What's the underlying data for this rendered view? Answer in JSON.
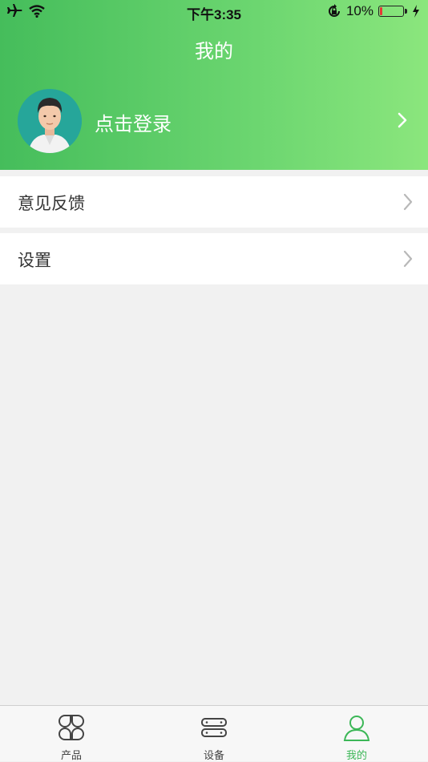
{
  "status_bar": {
    "time": "下午3:35",
    "battery_text": "10%",
    "battery_level": 0.1,
    "icons": [
      "airplane-icon",
      "wifi-icon",
      "rotation-lock-icon",
      "battery-icon",
      "charging-icon"
    ]
  },
  "header": {
    "title": "我的",
    "login_label": "点击登录",
    "gradient": [
      "#45bd5b",
      "#8be67d"
    ]
  },
  "menu": {
    "items": [
      {
        "label": "意见反馈"
      },
      {
        "label": "设置"
      }
    ]
  },
  "tabbar": {
    "tabs": [
      {
        "label": "产品",
        "icon": "grid-icon",
        "active": false
      },
      {
        "label": "设备",
        "icon": "device-icon",
        "active": false
      },
      {
        "label": "我的",
        "icon": "person-icon",
        "active": true
      }
    ],
    "active_color": "#3cb757"
  }
}
